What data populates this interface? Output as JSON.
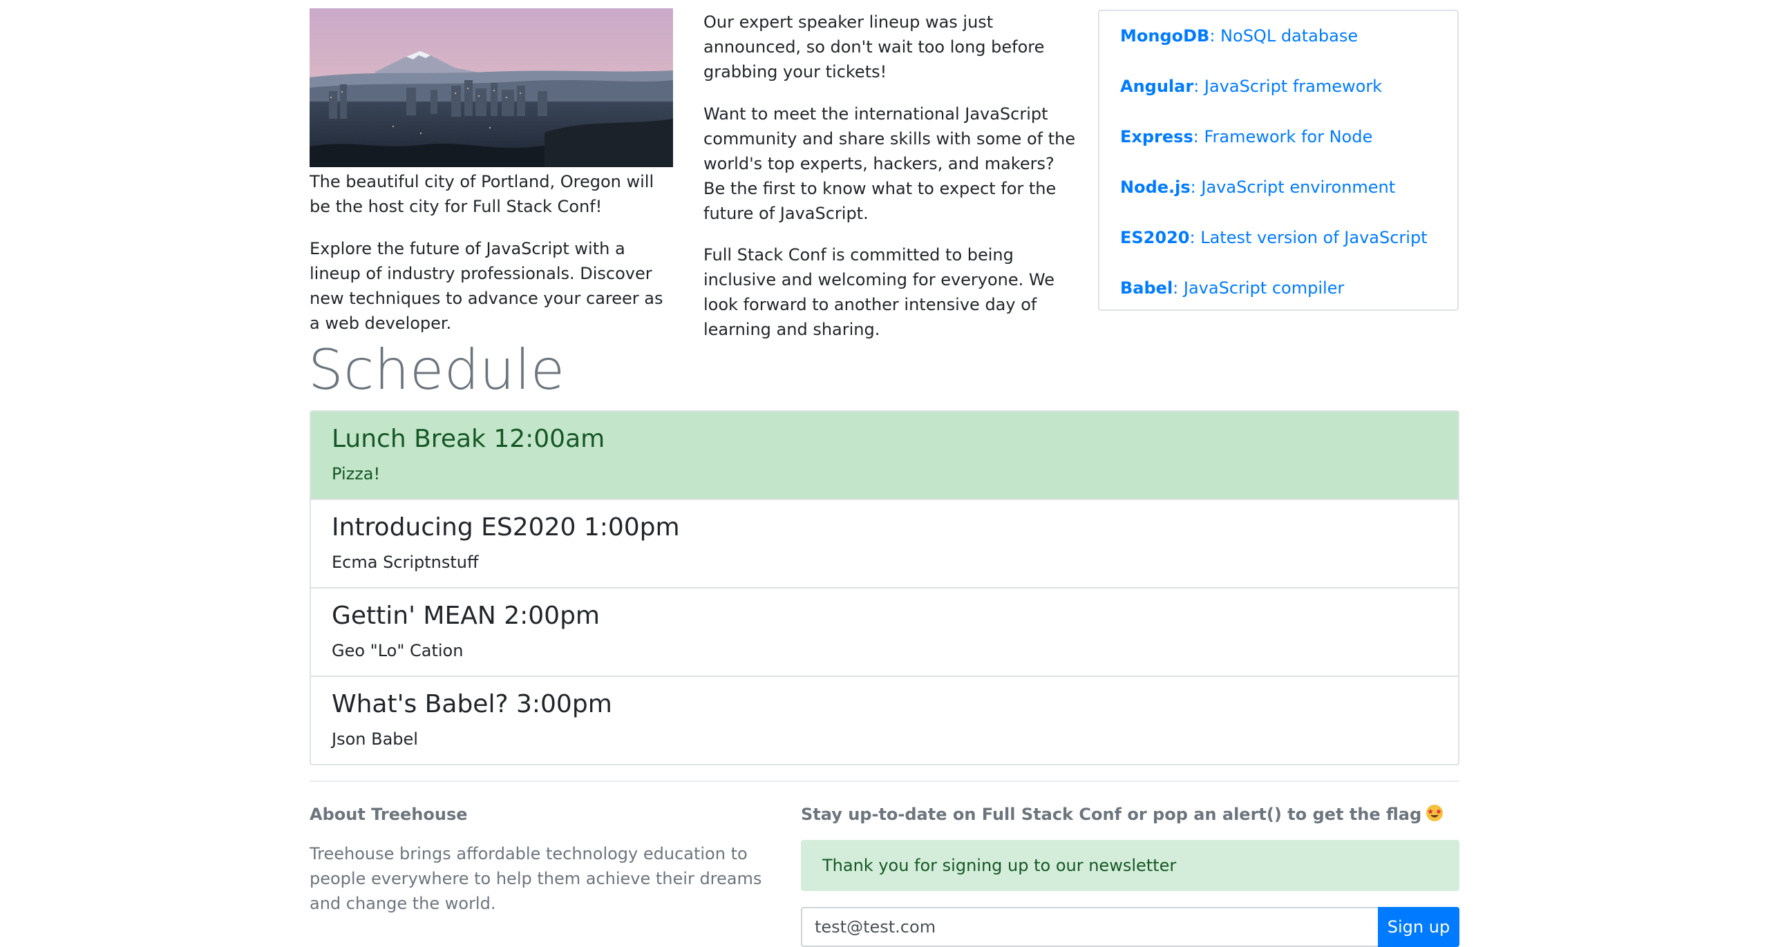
{
  "hero": {
    "caption": "The beautiful city of Portland, Oregon will be the host city for Full Stack Conf!",
    "explore": "Explore the future of JavaScript with a lineup of industry professionals. Discover new techniques to advance your career as a web developer."
  },
  "middle": {
    "p1": "Our expert speaker lineup was just announced, so don't wait too long before grabbing your tickets!",
    "p2": "Want to meet the international JavaScript community and share skills with some of the world's top experts, hackers, and makers? Be the first to know what to expect for the future of JavaScript.",
    "p3": "Full Stack Conf is committed to being inclusive and welcoming for everyone. We look forward to another intensive day of learning and sharing."
  },
  "tech": [
    {
      "name": "MongoDB",
      "desc": ": NoSQL database"
    },
    {
      "name": "Angular",
      "desc": ": JavaScript framework"
    },
    {
      "name": "Express",
      "desc": ": Framework for Node"
    },
    {
      "name": "Node.js",
      "desc": ": JavaScript environment"
    },
    {
      "name": "ES2020",
      "desc": ": Latest version of JavaScript"
    },
    {
      "name": "Babel",
      "desc": ": JavaScript compiler"
    }
  ],
  "schedule": {
    "title": "Schedule",
    "items": [
      {
        "title": "Lunch Break 12:00am",
        "sub": "Pizza!"
      },
      {
        "title": "Introducing ES2020 1:00pm",
        "sub": "Ecma Scriptnstuff"
      },
      {
        "title": "Gettin' MEAN 2:00pm",
        "sub": "Geo \"Lo\" Cation"
      },
      {
        "title": "What's Babel? 3:00pm",
        "sub": "Json Babel"
      }
    ]
  },
  "footer": {
    "about_title": "About Treehouse",
    "about_text": "Treehouse brings affordable technology education to people everywhere to help them achieve their dreams and change the world.",
    "newsletter_title": "Stay up-to-date on Full Stack Conf or pop an alert() to get the flag",
    "alert_text": "Thank you for signing up to our newsletter",
    "email_value": "test@test.com",
    "signup_label": "Sign up"
  },
  "colors": {
    "link": "#007bff",
    "success_bg": "#c3e6cb",
    "alert_bg": "#d4edda",
    "success_text": "#155724",
    "muted": "#6c757d"
  }
}
